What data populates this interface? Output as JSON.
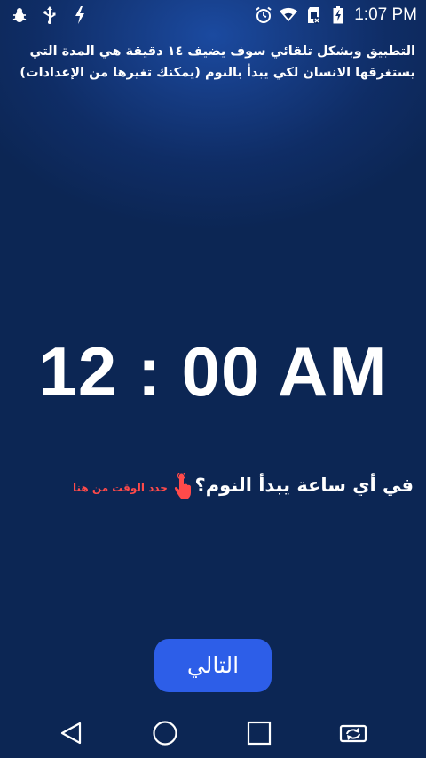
{
  "status_bar": {
    "time": "1:07 PM",
    "left_icons": [
      "bug-icon",
      "usb-icon",
      "charging-bolt-icon"
    ],
    "right_icons": [
      "alarm-clock-icon",
      "wifi-icon",
      "sim-card-off-icon",
      "battery-charging-icon"
    ]
  },
  "description": "التطبيق وبشكل تلقائي سوف يضيف ١٤ دقيقة هي المدة التي يستغرقها الانسان لكي يبدأ بالنوم (يمكنك تغيرها من الإعدادات)",
  "time_picker": {
    "hour": "12",
    "separator": ":",
    "minute": "00",
    "period": "AM"
  },
  "question": "في أي ساعة يبدأ النوم؟",
  "hint": {
    "text": "حدد الوقت من هنا",
    "icon": "tap-finger-icon",
    "color": "#ff4a4a"
  },
  "next_button": {
    "label": "التالي",
    "color": "#2d5ee8"
  },
  "nav_bar": {
    "buttons": [
      "back-icon",
      "home-icon",
      "recents-icon",
      "rotate-screen-icon"
    ]
  },
  "colors": {
    "background": "#0c2654",
    "accent": "#2d5ee8"
  }
}
